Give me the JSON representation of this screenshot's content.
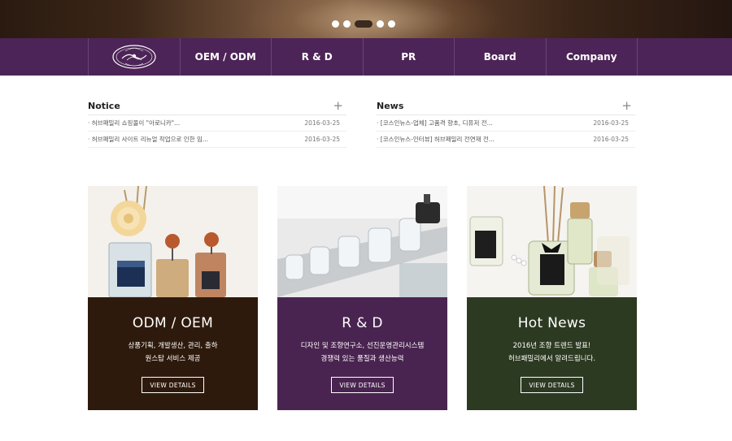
{
  "colors": {
    "nav": "#4d2457",
    "card_oem": "#2e1a0c",
    "card_rd": "#4a2450",
    "card_news": "#2d3a22"
  },
  "slider": {
    "dots": 5,
    "active_index": 2
  },
  "nav": {
    "logo_icon": "herb-family-logo",
    "items": [
      "OEM / ODM",
      "R & D",
      "PR",
      "Board",
      "Company"
    ]
  },
  "notice": {
    "title": "Notice",
    "more": "+",
    "rows": [
      {
        "text": "· 허브패밀리 쇼핑몰이 \"아로니카\"...",
        "date": "2016-03-25"
      },
      {
        "text": "· 허브패밀리 사이트 리뉴얼 작업으로 인한 임...",
        "date": "2016-03-25"
      }
    ]
  },
  "news": {
    "title": "News",
    "more": "+",
    "rows": [
      {
        "text": "· [코스인뉴스-업체] 고품격 향초, 디퓨저 전...",
        "date": "2016-03-25"
      },
      {
        "text": "· [코스인뉴스-인터뷰] 허브패밀리 전연재 전...",
        "date": "2016-03-25"
      }
    ]
  },
  "cards": [
    {
      "title": "ODM / OEM",
      "line1": "상품기획, 개발생산, 관리, 출하",
      "line2": "원스탑 서비스 제공",
      "button": "VIEW DETAILS"
    },
    {
      "title": "R & D",
      "line1": "디자인 및 조향연구소, 선진운영관리시스템",
      "line2": "경쟁력 있는 품질과 생산능력",
      "button": "VIEW DETAILS"
    },
    {
      "title": "Hot News",
      "line1": "2016년 조향 트렌드 발표!",
      "line2": "허브패밀리에서 알려드립니다.",
      "button": "VIEW DETAILS"
    }
  ]
}
